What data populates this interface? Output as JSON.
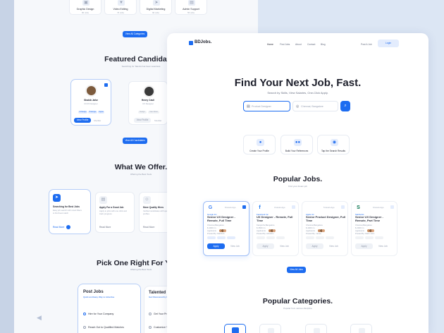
{
  "background_page": {
    "categories_top": [
      {
        "label": "Graphic Design",
        "sub": "80 Jobs"
      },
      {
        "label": "Video Editing",
        "sub": "76 Jobs"
      },
      {
        "label": "Digital Marketing",
        "sub": "96 Jobs"
      },
      {
        "label": "Admin Support",
        "sub": "55 Jobs"
      }
    ],
    "view_all_categories": "View All Categories",
    "featured_title": "Featured Candidates",
    "featured_sub": "Searching for Talents has been seamless",
    "candidates": [
      {
        "name": "Shakib Jafor",
        "role": "UI/UX Designer",
        "tags": [
          "UI Design",
          "Prototype",
          "Figma"
        ],
        "view": "View Profile",
        "hire": "Shortlist"
      },
      {
        "name": "Henry Cavil",
        "role": "UX Designer",
        "tags": [
          "Design",
          "User Flows"
        ],
        "view": "View Profile",
        "hire": "Shortlist"
      }
    ],
    "view_all_candidates": "View All Candidates",
    "offer_title": "What We Offer.",
    "offer_sub": "Offering the Best Tools",
    "offers": [
      {
        "title": "Searching for Best Jobs",
        "text": "Easy job search with smart filters to find best match",
        "link": "Read More"
      },
      {
        "title": "Apply For a Good Job",
        "text": "Apply to jobs with one click and track progress",
        "link": "Read More"
      },
      {
        "title": "More Quality Hires",
        "text": "Verified candidates with quality profiles",
        "link": "Read More"
      }
    ],
    "pick_title": "Pick One Right For You",
    "pick_sub": "Offering the Best Tools",
    "plans": [
      {
        "title": "Post Jobs",
        "sub": "Quick and Easy Way to Advertise",
        "items": [
          "Hire for Your Company",
          "Reach Out to Qualified Matches"
        ]
      },
      {
        "title": "Talented Candidates",
        "sub": "Get Discovered by Employers",
        "items": [
          "Get Your Profile",
          "Customize Your"
        ]
      }
    ]
  },
  "brand": "BDJobs.",
  "nav": [
    "Home",
    "Find Jobs",
    "About",
    "Contact",
    "Blog"
  ],
  "post_job": "Post A Job",
  "login": "Login",
  "hero": {
    "title": "Find Your Next Job, Fast.",
    "subtitle": "Search by Skills, View Salaries, One-Click Apply.",
    "search_placeholder": "Product Designer",
    "location_placeholder": "Chennai, Bangalore"
  },
  "steps": [
    "Create Your Profile",
    "Build Your References",
    "Tap the Search Results"
  ],
  "popular_jobs": {
    "title": "Popular Jobs.",
    "subtitle": "Find your dream job",
    "jobs": [
      {
        "company": "Google Inc",
        "logo": "G",
        "logo_color": "#4285f4",
        "posted": "8 Hours Ago",
        "title": "Senior UX Designer - Remote, Full Time",
        "location": "Chennai,Bangalore",
        "salary": "$ 4000 /m",
        "applicants": "Applicants",
        "posted_by": "Posted By: Mahbub",
        "apply": "Apply",
        "view": "View Job",
        "active": true
      },
      {
        "company": "Facebook Inc",
        "logo": "f",
        "logo_color": "#1877f2",
        "posted": "3 Hours Ago",
        "title": "UX Designer - Remote, Full Time",
        "location": "Kangrohs,Bangalore",
        "salary": "$ 3500 /m",
        "applicants": "Applicants",
        "posted_by": "Posted By: Abrahim",
        "apply": "Apply",
        "view": "View Job",
        "active": false
      },
      {
        "company": "Apple Inc",
        "logo": "",
        "logo_color": "#111111",
        "posted": "5 Hours Ago",
        "title": "Senior Product Designer, Full Time",
        "location": "Chennai,Bangalore",
        "salary": "$ 4000 /m",
        "applicants": "Applicants",
        "posted_by": "Posted By: Jamie",
        "apply": "Apply",
        "view": "View Job",
        "active": false
      },
      {
        "company": "Starbucks",
        "logo": "S",
        "logo_color": "#00704a",
        "posted": "9 Hours Ago",
        "title": "Senior UX Designer - Remote, Part Time",
        "location": "Chennai,Bangalore",
        "salary": "$ 2000 /m",
        "applicants": "Applicants",
        "posted_by": "Posted By: Mark John",
        "apply": "Apply",
        "view": "View Job",
        "active": false
      }
    ],
    "view_all": "View All Jobs"
  },
  "popular_categories": {
    "title": "Popular Categories.",
    "subtitle": "Popular from various discipline"
  },
  "colors": {
    "accent": "#1d6cf0",
    "text": "#1d1f2b",
    "muted": "#9aa3b5"
  }
}
